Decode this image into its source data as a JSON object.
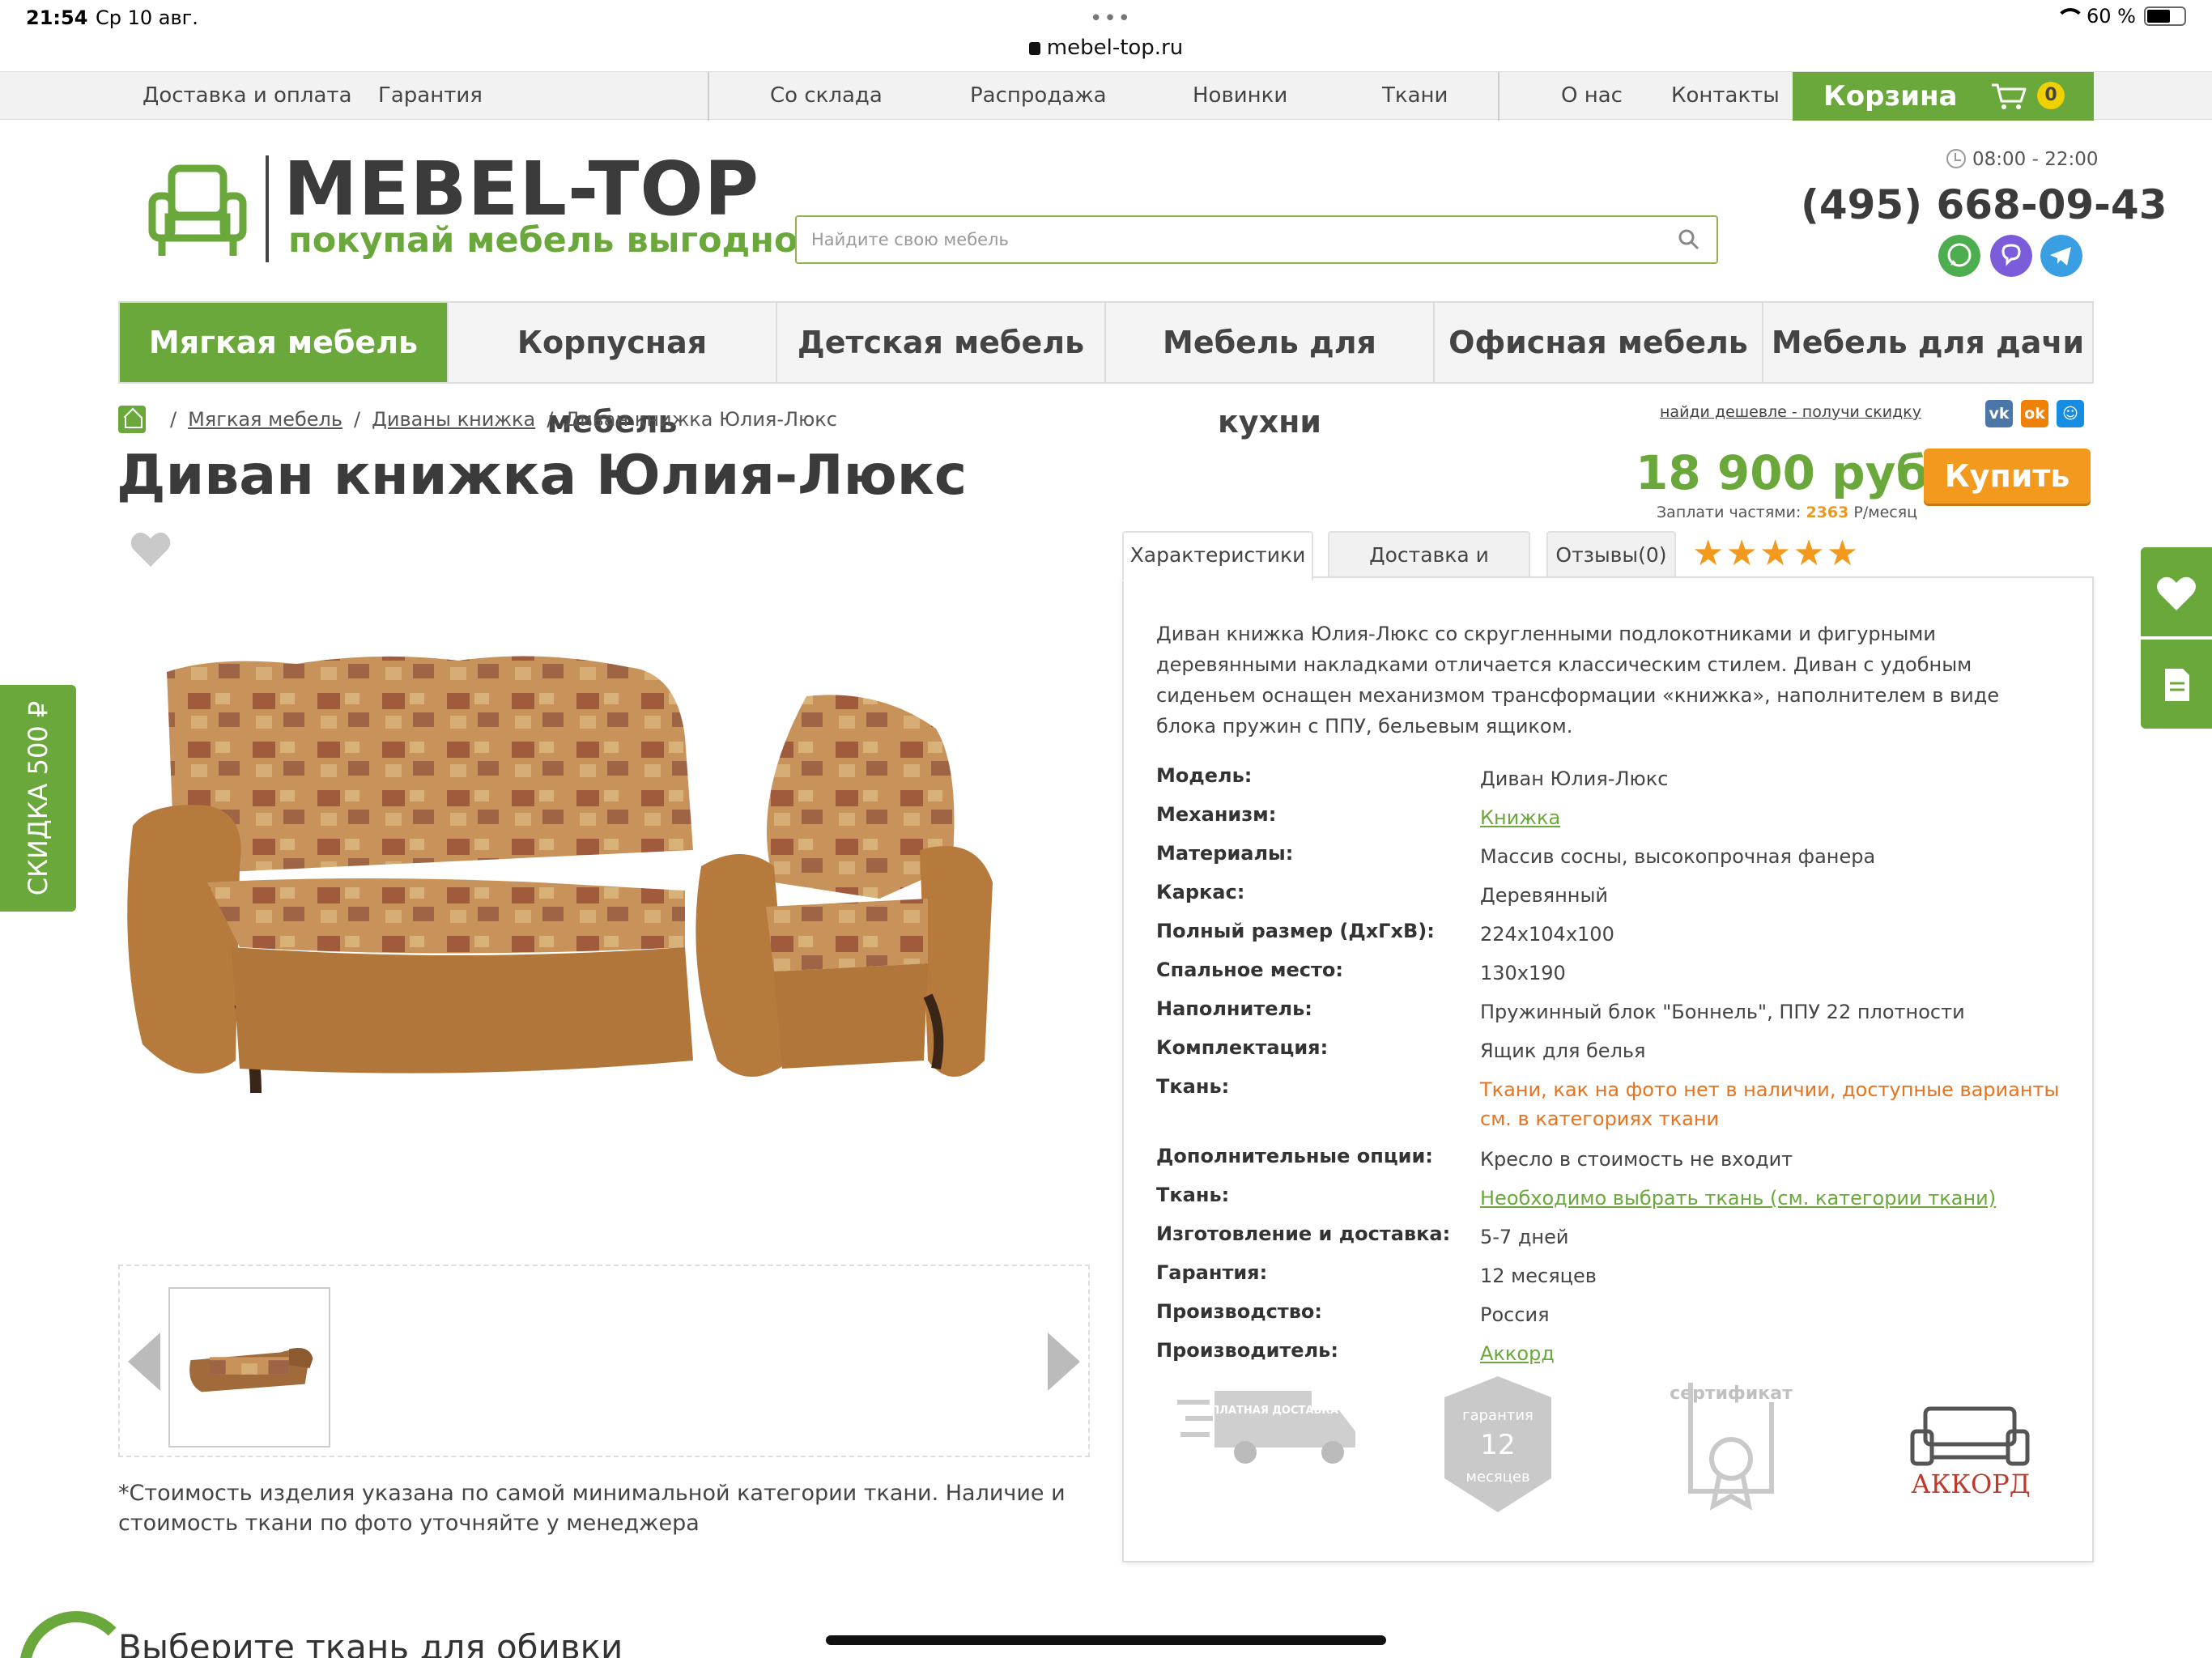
{
  "status": {
    "time": "21:54",
    "date": "Ср 10 авг.",
    "url": "mebel-top.ru",
    "battery": "60 %"
  },
  "topnav": {
    "items": [
      "Доставка и оплата",
      "Гарантия",
      "Со склада",
      "Распродажа",
      "Новинки",
      "Ткани",
      "О нас",
      "Контакты"
    ],
    "cart_label": "Корзина",
    "cart_count": "0"
  },
  "header": {
    "logo_title": "MEBEL-TOP",
    "logo_slogan": "покупай мебель выгодно",
    "search_placeholder": "Найдите свою мебель",
    "hours": "08:00 - 22:00",
    "phone": "(495) 668-09-43",
    "messengers": [
      "whatsapp-icon",
      "viber-icon",
      "telegram-icon"
    ]
  },
  "mainnav": {
    "items": [
      "Мягкая мебель",
      "Корпусная мебель",
      "Детская мебель",
      "Мебель для кухни",
      "Офисная мебель",
      "Мебель для дачи"
    ],
    "active_index": 0
  },
  "breadcrumb": {
    "items": [
      "Мягкая мебель",
      "Диваны книжка",
      "Диван книжка Юлия-Люкс"
    ]
  },
  "share": {
    "cheaper_link": "найди дешевле - получи скидку",
    "vk": "vk",
    "ok": "ok",
    "mm": "☺"
  },
  "product": {
    "title": "Диван книжка Юлия-Люкс",
    "price": "18 900 руб.",
    "installment_prefix": "Заплати частями:",
    "installment_amount": "2363",
    "installment_suffix": "Р/месяц",
    "buy_label": "Купить",
    "note": "*Стоимость изделия указана по самой минимальной категории ткани. Наличие и стоимость ткани по фото уточняйте у менеджера"
  },
  "tabs": {
    "items": [
      "Характеристики",
      "Доставка и оплата",
      "Отзывы(0)"
    ],
    "active_index": 0,
    "rating": "★★★★★",
    "rating_value": 5
  },
  "specs": {
    "description": "Диван книжка Юлия-Люкс со скругленными подлокотниками и фигурными деревянными накладками отличается классическим стилем. Диван с удобным сиденьем оснащен механизмом трансформации «книжка», наполнителем в виде блока пружин с ППУ, бельевым ящиком.",
    "rows": [
      {
        "label": "Модель:",
        "value": "Диван Юлия-Люкс",
        "style": "plain"
      },
      {
        "label": "Механизм:",
        "value": "Книжка",
        "style": "link"
      },
      {
        "label": "Материалы:",
        "value": "Массив сосны, высокопрочная фанера",
        "style": "plain"
      },
      {
        "label": "Каркас:",
        "value": "Деревянный",
        "style": "plain"
      },
      {
        "label": "Полный размер (ДхГхВ):",
        "value": "224x104x100",
        "style": "plain"
      },
      {
        "label": "Спальное место:",
        "value": "130x190",
        "style": "plain"
      },
      {
        "label": "Наполнитель:",
        "value": "Пружинный блок \"Боннель\", ППУ 22 плотности",
        "style": "plain"
      },
      {
        "label": "Комплектация:",
        "value": "Ящик для белья",
        "style": "plain"
      },
      {
        "label": "Ткань:",
        "value": "Ткани, как на фото нет в наличии, доступные варианты см. в категориях ткани",
        "style": "warn"
      },
      {
        "label": "Дополнительные опции:",
        "value": "Кресло в стоимость не входит",
        "style": "plain"
      },
      {
        "label": "Ткань:",
        "value": "Необходимо выбрать ткань (см. категории ткани)",
        "style": "link"
      },
      {
        "label": "Изготовление и доставка:",
        "value": "5-7 дней",
        "style": "plain"
      },
      {
        "label": "Гарантия:",
        "value": "12 месяцев",
        "style": "plain"
      },
      {
        "label": "Производство:",
        "value": "Россия",
        "style": "plain"
      },
      {
        "label": "Производитель:",
        "value": "Аккорд",
        "style": "link"
      }
    ]
  },
  "badges": {
    "delivery": "БЕСПЛАТНАЯ ДОСТАВКА",
    "warranty_top": "гарантия",
    "warranty_num": "12",
    "warranty_bottom": "месяцев",
    "certificate": "сертификат",
    "brand": "АККОРД"
  },
  "side": {
    "discount": "СКИДКА 500 ₽"
  },
  "bottom": {
    "title": "Выберите ткань для обивки"
  },
  "colors": {
    "green": "#6aa83c",
    "orange": "#f39a1e"
  }
}
